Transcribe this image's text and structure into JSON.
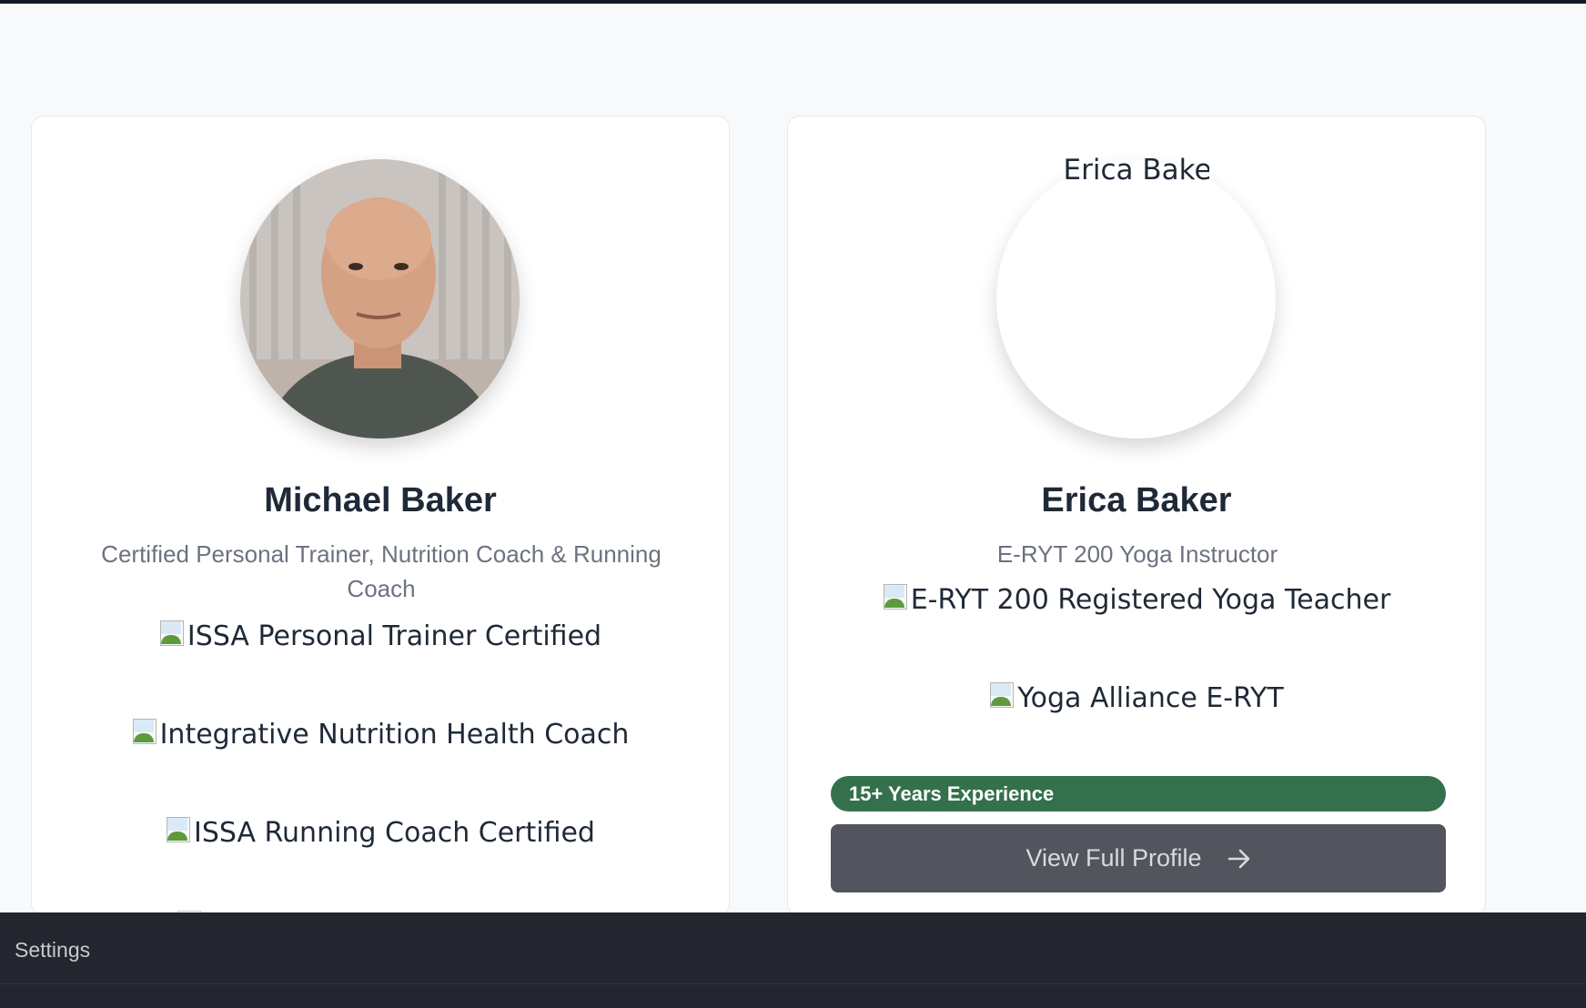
{
  "profiles": [
    {
      "name": "Michael Baker",
      "role": "Certified Personal Trainer, Nutrition Coach & Running Coach",
      "certifications": [
        "ISSA Personal Trainer Certified",
        "Integrative Nutrition Health Coach",
        "ISSA Running Coach Certified"
      ]
    },
    {
      "name": "Erica Baker",
      "photo_alt": "Erica Baker",
      "role": "E-RYT 200 Yoga Instructor",
      "certifications": [
        "E-RYT 200 Registered Yoga Teacher",
        "Yoga Alliance E-RYT"
      ],
      "experience_badge": "15+ Years Experience",
      "view_button": "View Full Profile"
    }
  ],
  "footer": {
    "settings_label": "Settings"
  },
  "colors": {
    "badge_green": "#34704c",
    "button_gray": "#52545e",
    "footer_bg": "#23262e"
  },
  "icons": {
    "arrow": "arrow-right-icon",
    "broken_image": "broken-image-icon"
  }
}
